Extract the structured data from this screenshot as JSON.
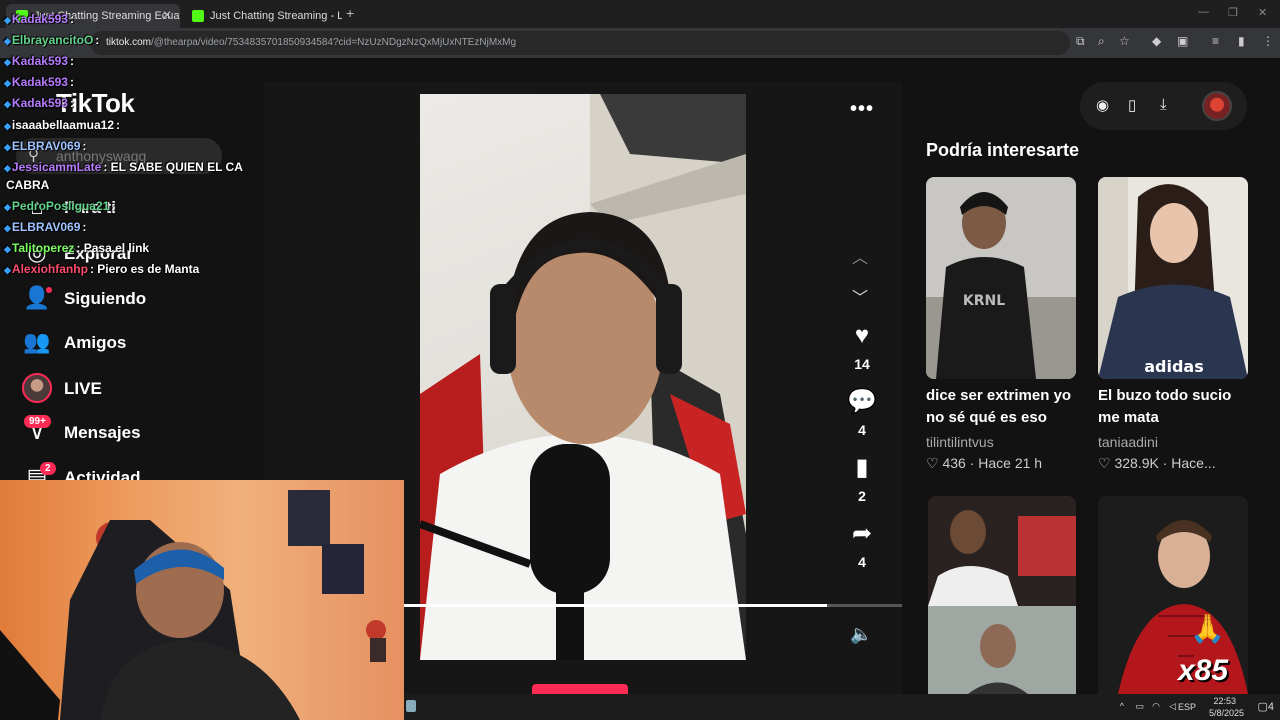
{
  "browser": {
    "tabs": [
      {
        "title": "Just Chatting Streaming Ecuatoriano",
        "active": true
      },
      {
        "title": "Just Chatting Streaming - Live",
        "active": false
      }
    ],
    "new_tab": "+",
    "url_host": "tiktok.com",
    "url_path": "/@thearpa/video/7534835701850934584?cid=NzUzNDgzNzQxMjUxNTEzNjMxMg"
  },
  "chat": [
    {
      "user": "Kadak593",
      "msg": ":",
      "color": "#b77cff"
    },
    {
      "user": "ElbrayancitoO",
      "msg": ":",
      "color": "#63d38c"
    },
    {
      "user": "Kadak593",
      "msg": ":",
      "color": "#b77cff"
    },
    {
      "user": "Kadak593",
      "msg": ":",
      "color": "#b77cff"
    },
    {
      "user": "Kadak593",
      "msg": ":",
      "color": "#b77cff"
    },
    {
      "user": "isaaabellaamua12",
      "msg": ":",
      "color": "#ffffff"
    },
    {
      "user": "ELBRAV069",
      "msg": ":",
      "color": "#9ec3ff"
    },
    {
      "user": "JessicammLate",
      "msg": ": EL SABE QUIEN EL CA",
      "color": "#b77cff"
    },
    {
      "user": "",
      "msg": "CABRA",
      "color": "#ffffff"
    },
    {
      "user": "PedroPosligua21",
      "msg": ":",
      "color": "#63d38c"
    },
    {
      "user": "ELBRAV069",
      "msg": ":",
      "color": "#9ec3ff"
    },
    {
      "user": "Talitoperez",
      "msg": ": Pasa el link",
      "color": "#7cff63"
    },
    {
      "user": "Alexiohfanhp",
      "msg": ": Piero es de Manta",
      "color": "#ff4d6d"
    }
  ],
  "sidebar": {
    "logo": "TikTok",
    "search_value": "anthonyswagg",
    "items": [
      {
        "label": "Para ti",
        "icon": "home-icon"
      },
      {
        "label": "Explorar",
        "icon": "compass-icon"
      },
      {
        "label": "Siguiendo",
        "icon": "following-icon"
      },
      {
        "label": "Amigos",
        "icon": "friends-icon"
      },
      {
        "label": "LIVE",
        "icon": "live-avatar"
      },
      {
        "label": "Mensajes",
        "icon": "inbox-icon",
        "badge": "99+"
      },
      {
        "label": "Actividad",
        "icon": "activity-icon",
        "badge": "2"
      }
    ]
  },
  "video": {
    "progress_fraction": 0.85,
    "actions": {
      "likes": "14",
      "comments": "4",
      "saves": "2",
      "shares": "4"
    }
  },
  "recommendations": {
    "title": "Podría interesarte",
    "cards": [
      {
        "title": "dice ser extrimen yo no sé qué es eso",
        "author": "tilintilintvus",
        "likes": "436",
        "time": "Hace 21 h"
      },
      {
        "title": "El buzo todo sucio me mata",
        "author": "taniaadini",
        "likes": "328.9K",
        "time": "Hace..."
      }
    ]
  },
  "overlay": {
    "combo": "x85"
  },
  "taskbar": {
    "lang": "ESP",
    "time": "22:53",
    "date": "5/8/2025",
    "notif": "4"
  }
}
